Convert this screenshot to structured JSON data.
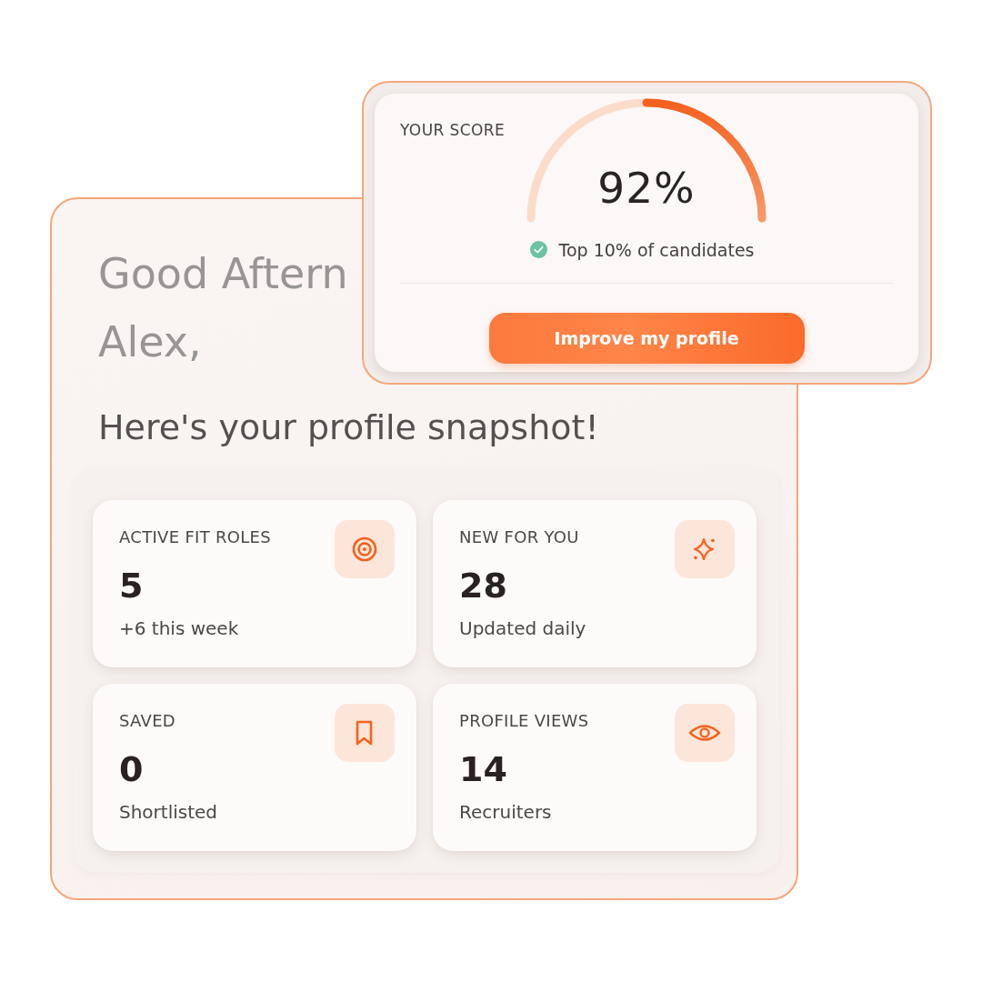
{
  "score": {
    "label": "YOUR SCORE",
    "gauge": {
      "level": 0.5
    },
    "value": "92%",
    "note": "Top 10% of candidates",
    "button": "Improve my profile"
  },
  "greeting": {
    "lines": [
      "Good Aftern",
      "Alex,"
    ],
    "subtitle": "Here's your profile snapshot!"
  },
  "stats": [
    {
      "label": "ACTIVE FIT ROLES",
      "value": "5",
      "note": "+6 this week"
    },
    {
      "label": "NEW FOR YOU",
      "value": "28",
      "note": "Updated daily"
    },
    {
      "label": "SAVED",
      "value": "0",
      "note": "Shortlisted"
    },
    {
      "label": "PROFILE VIEWS",
      "value": "14",
      "note": "Recruiters"
    }
  ]
}
